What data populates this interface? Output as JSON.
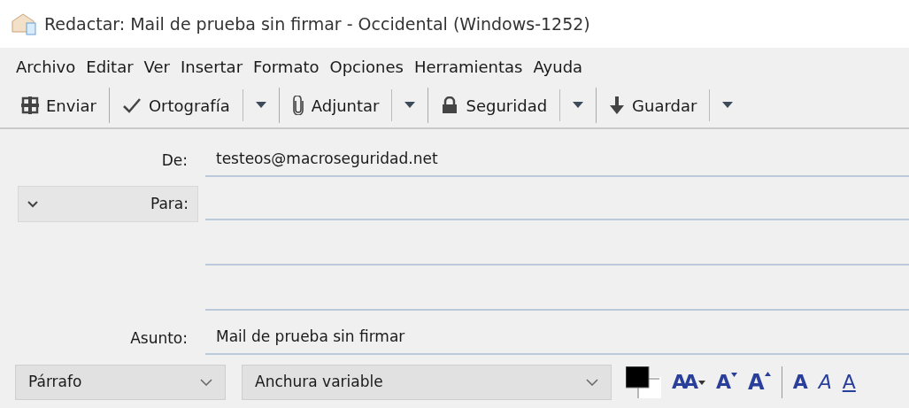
{
  "window": {
    "title": "Redactar: Mail de prueba sin firmar - Occidental (Windows-1252)"
  },
  "menu": [
    "Archivo",
    "Editar",
    "Ver",
    "Insertar",
    "Formato",
    "Opciones",
    "Herramientas",
    "Ayuda"
  ],
  "toolbar": [
    {
      "kind": "send",
      "label": "Enviar",
      "dropdown": false
    },
    {
      "kind": "spell",
      "label": "Ortografía",
      "dropdown": true
    },
    {
      "kind": "attach",
      "label": "Adjuntar",
      "dropdown": true
    },
    {
      "kind": "security",
      "label": "Seguridad",
      "dropdown": true
    },
    {
      "kind": "save",
      "label": "Guardar",
      "dropdown": true
    }
  ],
  "header": {
    "from_label": "De:",
    "from_value": "testeos@macroseguridad.net",
    "to_label": "Para:",
    "subject_label": "Asunto:",
    "subject_value": "Mail de prueba sin firmar"
  },
  "format_bar": {
    "paragraph": "Párrafo",
    "font": "Anchura variable",
    "buttons": [
      {
        "kind": "size",
        "label": "AA"
      },
      {
        "kind": "smaller",
        "label": "A"
      },
      {
        "kind": "larger",
        "label": "A"
      },
      {
        "kind": "bold",
        "label": "A"
      },
      {
        "kind": "italic",
        "label": "A"
      },
      {
        "kind": "underline",
        "label": "A"
      }
    ]
  }
}
